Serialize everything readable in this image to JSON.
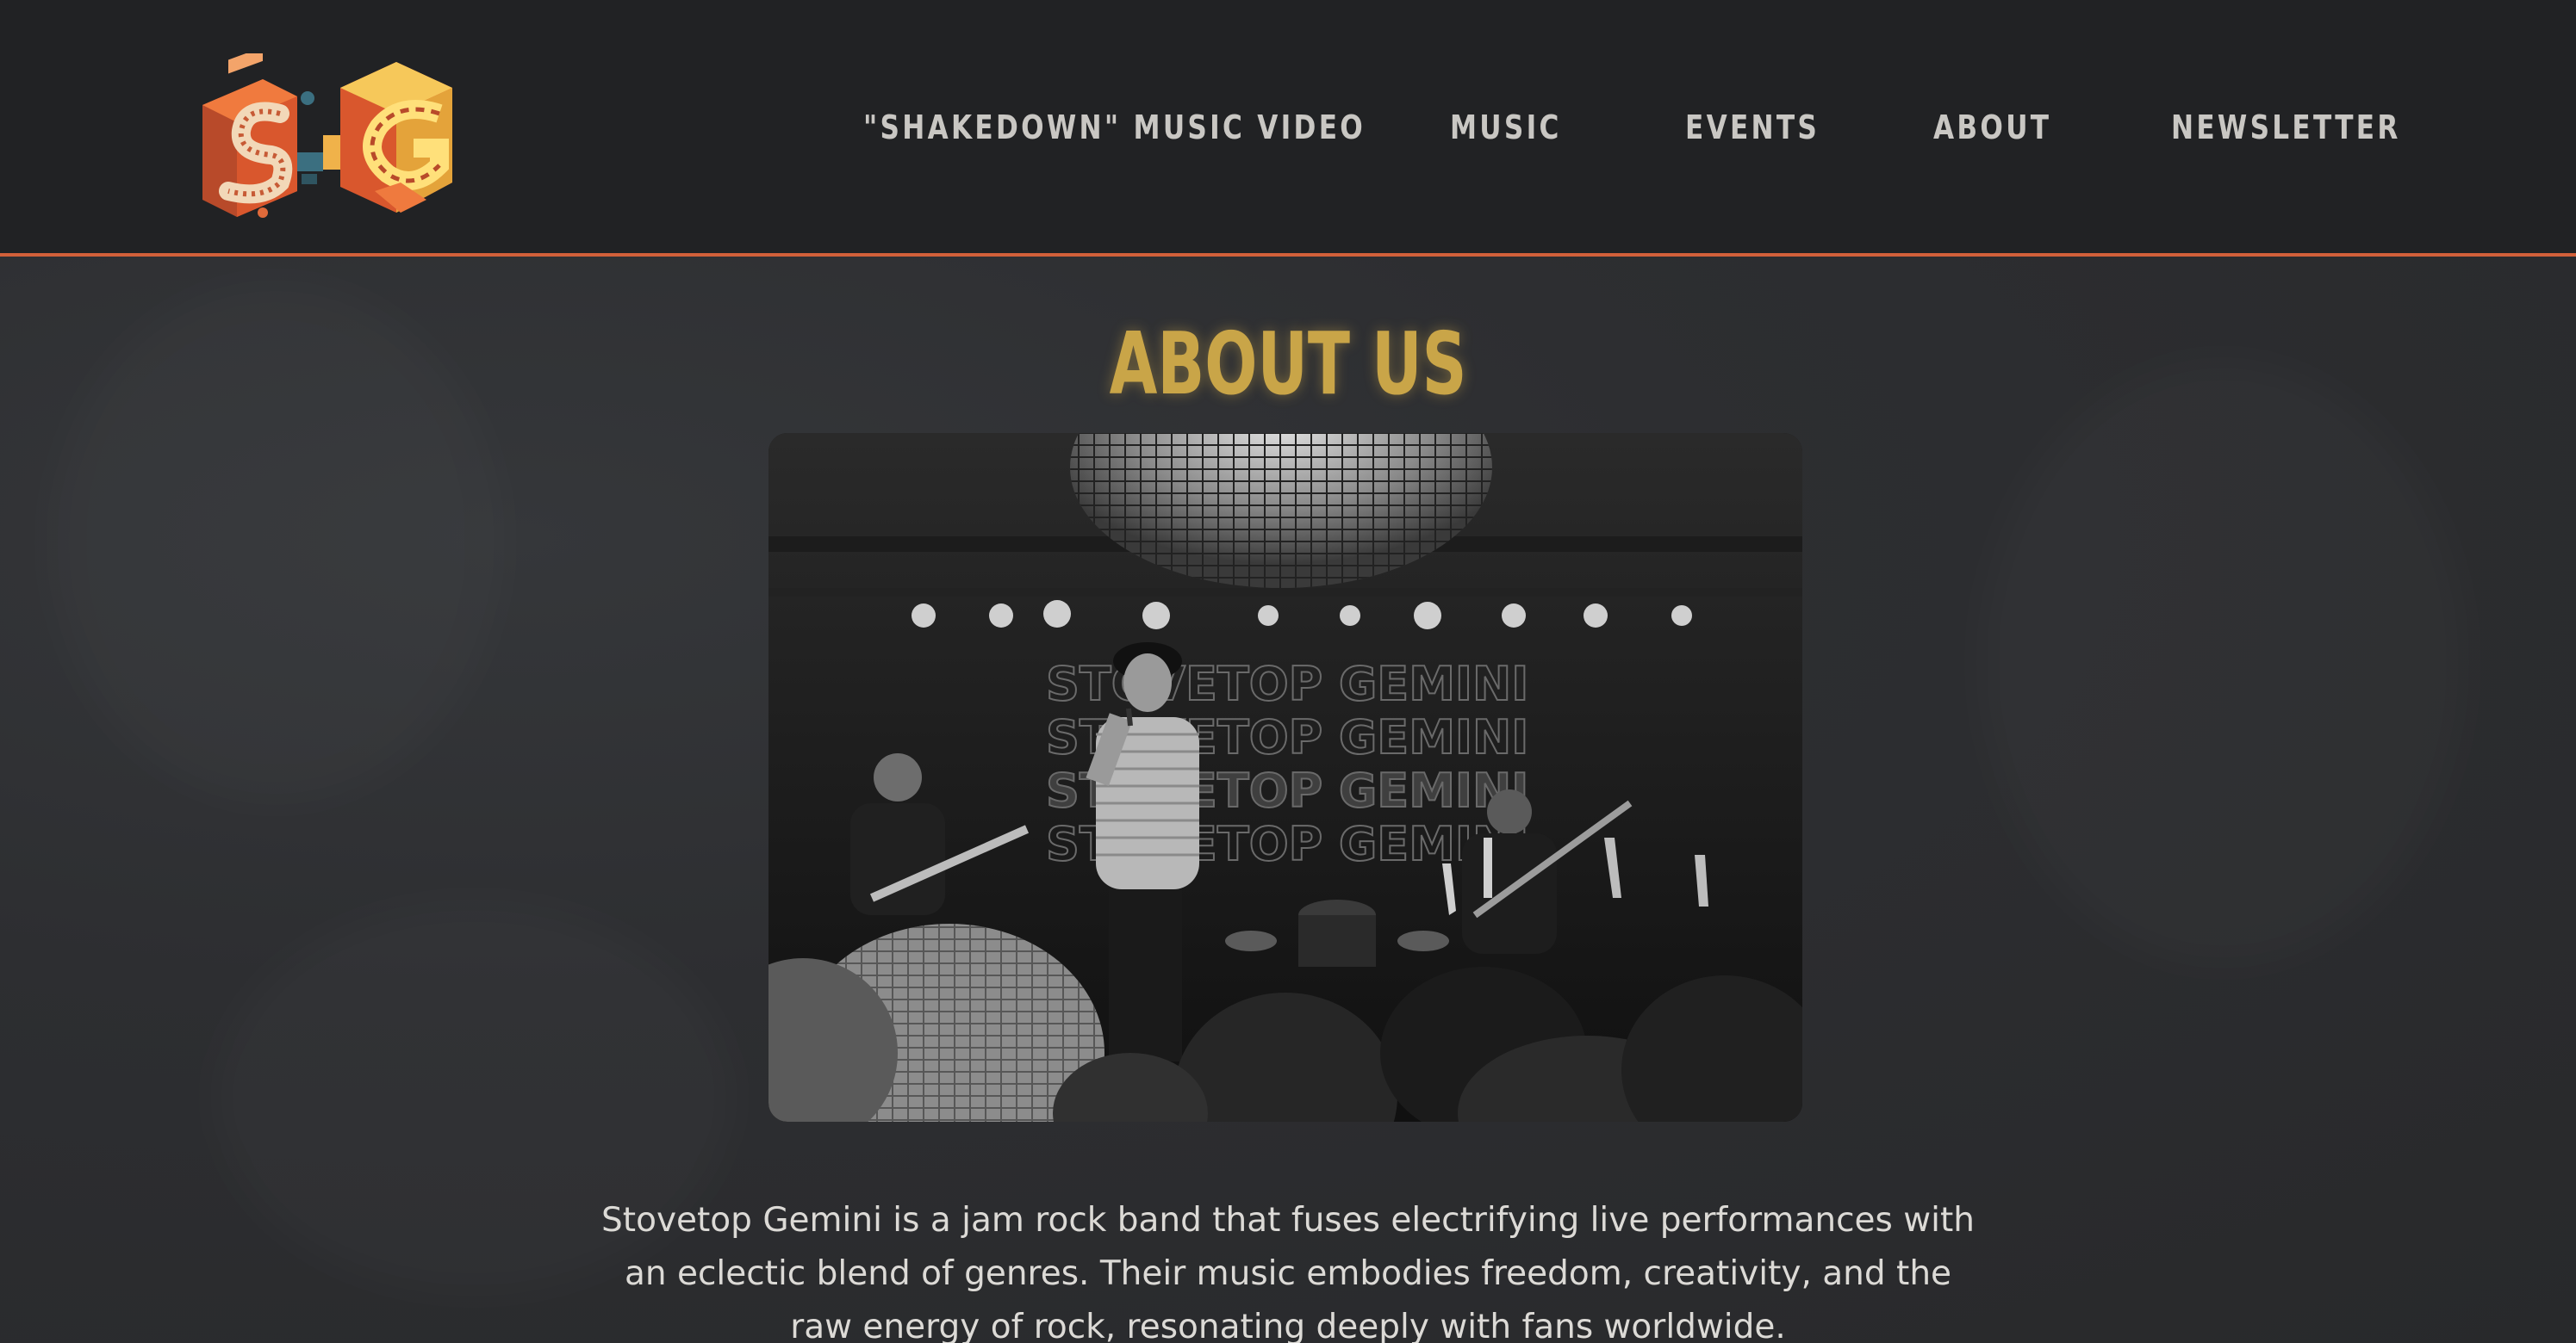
{
  "site": {
    "logo_icon": "sg-isometric-logo-icon",
    "logo_letters": "SG"
  },
  "nav": {
    "items": [
      {
        "label": "\"SHAKEDOWN\" MUSIC VIDEO"
      },
      {
        "label": "MUSIC"
      },
      {
        "label": "EVENTS"
      },
      {
        "label": "ABOUT"
      },
      {
        "label": "NEWSLETTER"
      }
    ]
  },
  "about": {
    "title": "ABOUT US",
    "photo_banner_text": "STOVETOP GEMINI",
    "description": "Stovetop Gemini is a jam rock band that fuses electrifying live performances with an eclectic blend of genres. Their music embodies freedom, creativity, and the raw energy of rock, resonating deeply with fans worldwide."
  },
  "colors": {
    "header_bg": "#212224",
    "accent_line": "#d2603a",
    "title_gold": "#c9a548",
    "nav_text": "#c9c7c3",
    "body_text": "#dcdad6",
    "page_bg": "#2d2e31"
  }
}
